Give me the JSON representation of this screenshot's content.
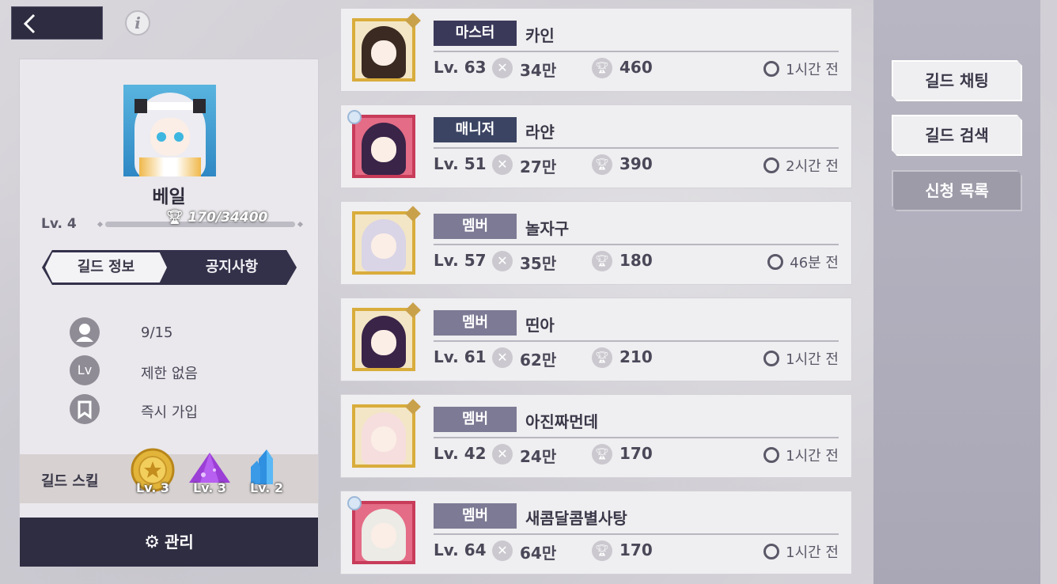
{
  "header": {
    "back_icon": "chevron-left-icon",
    "info_label": "i"
  },
  "profile": {
    "name": "베일",
    "level": "Lv. 4",
    "trophy_progress": "170/34400",
    "trophy_fraction": 0.005,
    "tabs": [
      {
        "label": "길드 정보",
        "active": true
      },
      {
        "label": "공지사항",
        "active": false
      }
    ],
    "info": [
      {
        "icon": "person-icon",
        "text": "9/15"
      },
      {
        "icon": "level-icon",
        "icon_label": "Lv",
        "text": "제한 없음"
      },
      {
        "icon": "bookmark-icon",
        "text": "즉시 가입"
      }
    ],
    "skills_label": "길드 스킬",
    "skills": [
      {
        "icon": "gold-medal-icon",
        "level": "Lv. 3"
      },
      {
        "icon": "purple-gem-icon",
        "level": "Lv. 3"
      },
      {
        "icon": "blue-crystal-icon",
        "level": "Lv. 2"
      }
    ],
    "manage_label": "관리"
  },
  "members": [
    {
      "rank": "마스터",
      "rank_color": "#3b395a",
      "name": "카인",
      "level": "Lv. 63",
      "power": "34만",
      "trophies": "460",
      "last_seen": "1시간 전",
      "frame": "gold",
      "hair": "#3a2a22"
    },
    {
      "rank": "매니저",
      "rank_color": "#3b4463",
      "name": "라얀",
      "level": "Lv. 51",
      "power": "27만",
      "trophies": "390",
      "last_seen": "2시간 전",
      "frame": "red",
      "hair": "#3a2448"
    },
    {
      "rank": "멤버",
      "rank_color": "#7c7a94",
      "name": "놀자구",
      "level": "Lv. 57",
      "power": "35만",
      "trophies": "180",
      "last_seen": "46분 전",
      "frame": "gold",
      "hair": "#d9d4e6"
    },
    {
      "rank": "멤버",
      "rank_color": "#7c7a94",
      "name": "띤아",
      "level": "Lv. 61",
      "power": "62만",
      "trophies": "210",
      "last_seen": "1시간 전",
      "frame": "gold",
      "hair": "#3a2448"
    },
    {
      "rank": "멤버",
      "rank_color": "#7c7a94",
      "name": "아진짜먼데",
      "level": "Lv. 42",
      "power": "24만",
      "trophies": "170",
      "last_seen": "1시간 전",
      "frame": "gold",
      "hair": "#f6dede"
    },
    {
      "rank": "멤버",
      "rank_color": "#7c7a94",
      "name": "새콤달콤별사탕",
      "level": "Lv. 64",
      "power": "64만",
      "trophies": "170",
      "last_seen": "1시간 전",
      "frame": "red",
      "hair": "#ecebe6"
    }
  ],
  "side_buttons": [
    {
      "label": "길드 채팅",
      "dim": false
    },
    {
      "label": "길드 검색",
      "dim": false
    },
    {
      "label": "신청 목록",
      "dim": true
    }
  ]
}
